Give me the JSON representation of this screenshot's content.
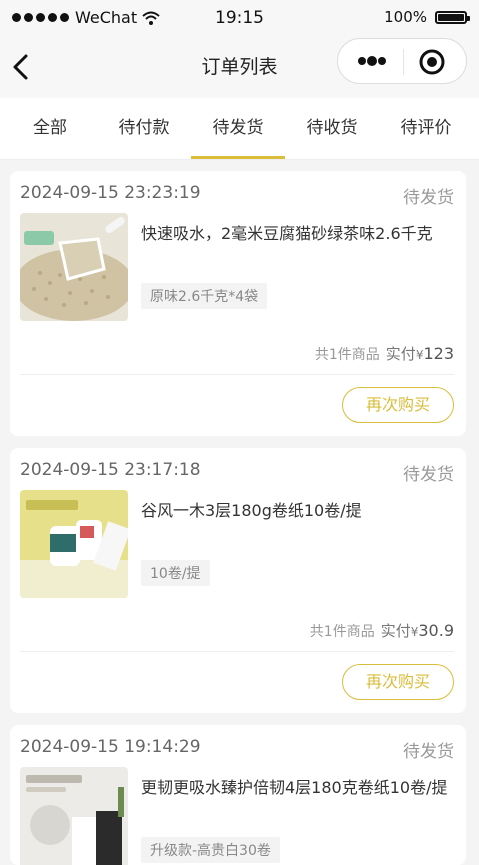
{
  "status_bar": {
    "carrier": "WeChat",
    "time": "19:15",
    "battery": "100%"
  },
  "nav": {
    "title": "订单列表"
  },
  "tabs": [
    {
      "label": "全部"
    },
    {
      "label": "待付款"
    },
    {
      "label": "待发货"
    },
    {
      "label": "待收货"
    },
    {
      "label": "待评价"
    }
  ],
  "active_tab": "待发货",
  "accent_color": "#d9bd3b",
  "orders": [
    {
      "time": "2024-09-15 23:23:19",
      "status": "待发货",
      "name": "快速吸水，2毫米豆腐猫砂绿茶味2.6千克",
      "spec": "原味2.6千克*4袋",
      "count_text": "共1件商品",
      "paid_label": "实付",
      "currency": "¥",
      "price": "123",
      "rebuy_label": "再次购买"
    },
    {
      "time": "2024-09-15 23:17:18",
      "status": "待发货",
      "name": "谷风一木3层180g卷纸10卷/提",
      "spec": "10卷/提",
      "count_text": "共1件商品",
      "paid_label": "实付",
      "currency": "¥",
      "price": "30.9",
      "rebuy_label": "再次购买"
    },
    {
      "time": "2024-09-15 19:14:29",
      "status": "待发货",
      "name": "更韧更吸水臻护倍韧4层180克卷纸10卷/提",
      "spec": "升级款-高贵白30卷"
    }
  ]
}
